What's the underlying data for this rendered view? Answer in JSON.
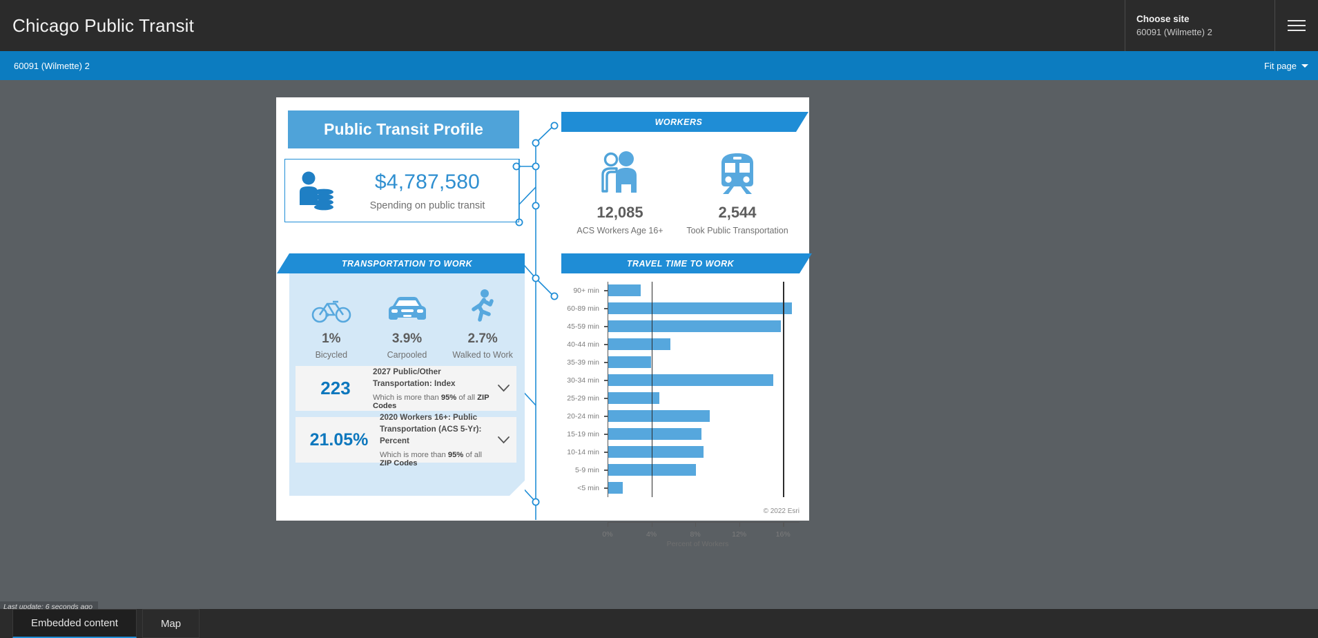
{
  "appbar": {
    "title": "Chicago Public Transit",
    "site_chooser_label": "Choose site",
    "site_chooser_value": "60091 (Wilmette) 2",
    "menu_icon": "hamburger-menu-icon"
  },
  "subbar": {
    "breadcrumb": "60091 (Wilmette) 2",
    "zoom_mode": "Fit page",
    "caret_icon": "chevron-down-icon"
  },
  "infographic": {
    "title": "Public Transit Profile",
    "spending": {
      "icon": "person-with-coins-icon",
      "value": "$4,787,580",
      "label": "Spending on public transit"
    },
    "workers": {
      "heading": "WORKERS",
      "stats": [
        {
          "icon": "two-people-icon",
          "value": "12,085",
          "caption": "ACS Workers Age 16+"
        },
        {
          "icon": "train-icon",
          "value": "2,544",
          "caption": "Took Public Transportation"
        }
      ]
    },
    "transportation": {
      "heading": "TRANSPORTATION TO WORK",
      "modes": [
        {
          "icon": "bicycle-icon",
          "value": "1%",
          "caption": "Bicycled"
        },
        {
          "icon": "car-icon",
          "value": "3.9%",
          "caption": "Carpooled"
        },
        {
          "icon": "walking-person-icon",
          "value": "2.7%",
          "caption": "Walked to Work"
        }
      ],
      "cards": [
        {
          "value": "223",
          "title": "2027 Public/Other Transportation: Index",
          "sub_pre": "Which is more than ",
          "sub_bold": "95%",
          "sub_post": " of all ",
          "sub_bold2": "ZIP Codes",
          "chevron": "chevron-down-icon"
        },
        {
          "value": "21.05%",
          "title": "2020 Workers 16+: Public Transportation (ACS 5-Yr): Percent",
          "sub_pre": "Which is more than ",
          "sub_bold": "95%",
          "sub_post": " of all ",
          "sub_bold2": "ZIP Codes",
          "chevron": "chevron-down-icon"
        }
      ]
    },
    "travel": {
      "heading": "TRAVEL TIME TO WORK"
    },
    "copyright": "© 2022 Esri"
  },
  "chart_data": {
    "type": "bar",
    "orientation": "horizontal",
    "title": "TRAVEL TIME TO WORK",
    "xlabel": "Percent of Workers",
    "ylabel": "",
    "xlim": [
      0,
      17.5
    ],
    "xticks": [
      0,
      4,
      8,
      12,
      16
    ],
    "xtick_labels": [
      "0%",
      "4%",
      "8%",
      "12%",
      "16%"
    ],
    "grid": false,
    "gridlines_at": [
      4,
      16
    ],
    "bar_color": "#56a7dd",
    "categories": [
      "90+ min",
      "60-89 min",
      "45-59 min",
      "40-44 min",
      "35-39 min",
      "30-34 min",
      "25-29 min",
      "20-24 min",
      "15-19 min",
      "10-14 min",
      "5-9 min",
      "<5 min"
    ],
    "values": [
      3.0,
      16.8,
      15.8,
      5.7,
      3.9,
      15.1,
      4.7,
      9.3,
      8.5,
      8.7,
      8.0,
      1.3
    ]
  },
  "status": {
    "last_update": "Last update: 6 seconds ago"
  },
  "taskbar": {
    "items": [
      {
        "label": "Embedded content",
        "active": true
      },
      {
        "label": "Map",
        "active": false
      }
    ]
  },
  "colors": {
    "accent_blue": "#1f8dd6",
    "light_blue": "#4fa3d9",
    "panel_bg": "#d4e8f7",
    "bar_blue": "#56a7dd",
    "stat_blue": "#0d77bd",
    "chrome_dark": "#2b2b2b",
    "stage_gray": "#5a5f63"
  }
}
